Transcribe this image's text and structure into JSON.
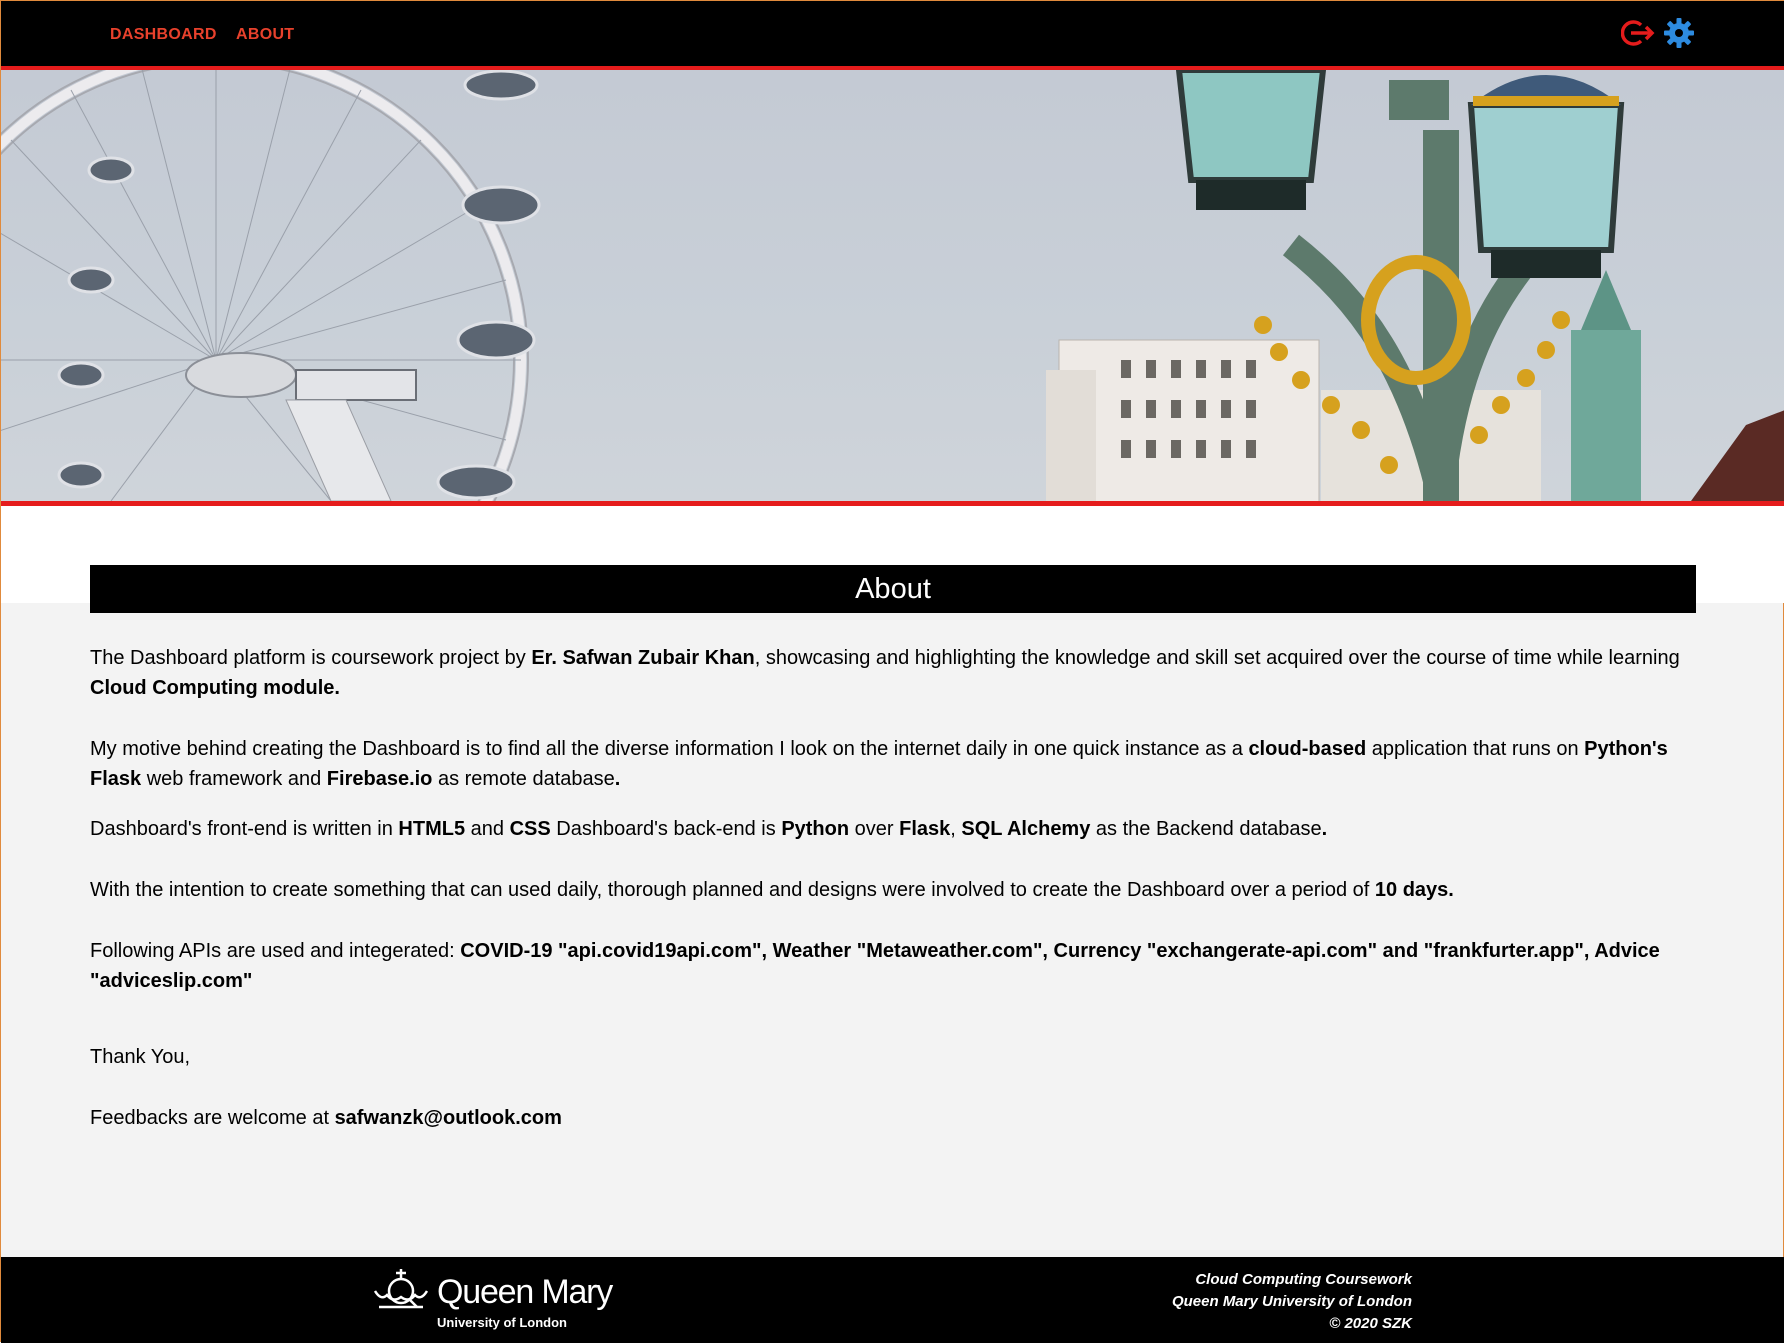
{
  "nav": {
    "links": [
      "DASHBOARD",
      "ABOUT"
    ],
    "icons": [
      "logout-icon",
      "settings-gear-icon"
    ],
    "accent_color": "#e8412c"
  },
  "page": {
    "title": "About"
  },
  "content": {
    "p1": {
      "t1": "The Dashboard platform is coursework project by ",
      "b1": "Er. Safwan Zubair Khan",
      "t2": ", showcasing and highlighting the knowledge and skill set acquired over the course of time while learning ",
      "b2": "Cloud Computing module."
    },
    "p2": {
      "t1": "My motive behind creating the Dashboard is to find all the diverse information I look on the internet daily in one quick instance as a ",
      "b1": "cloud-based",
      "t2": " application that runs on ",
      "b2": "Python's Flask",
      "t3": " web framework and ",
      "b3": "Firebase.io",
      "t4": " as remote database",
      "b4": "."
    },
    "p3": {
      "t1": "Dashboard's front-end is written in ",
      "b1": "HTML5",
      "t2": " and ",
      "b2": "CSS",
      "t3": " Dashboard's back-end is ",
      "b3": "Python",
      "t4": " over ",
      "b4": "Flask",
      "t5": ", ",
      "b5": "SQL Alchemy",
      "t6": " as the Backend database",
      "b6": "."
    },
    "p4": {
      "t1": "With the intention to create something that can used daily, thorough planned and designs were involved to create the Dashboard over a period of ",
      "b1": "10 days."
    },
    "p5": {
      "t1": "Following APIs are used and integerated: ",
      "b1": "COVID-19 \"api.covid19api.com\", Weather \"Metaweather.com\", Currency \"exchangerate-api.com\" and \"frankfurter.app\", Advice \"adviceslip.com\""
    },
    "p6": {
      "t1": "Thank You,"
    },
    "p7": {
      "t1": "Feedbacks are welcome at ",
      "b1": "safwanzk@outlook.com"
    }
  },
  "footer": {
    "logo_name": "Queen Mary",
    "logo_sub": "University of London",
    "lines": [
      "Cloud Computing Coursework",
      "Queen Mary University of London",
      "© 2020 SZK"
    ]
  }
}
